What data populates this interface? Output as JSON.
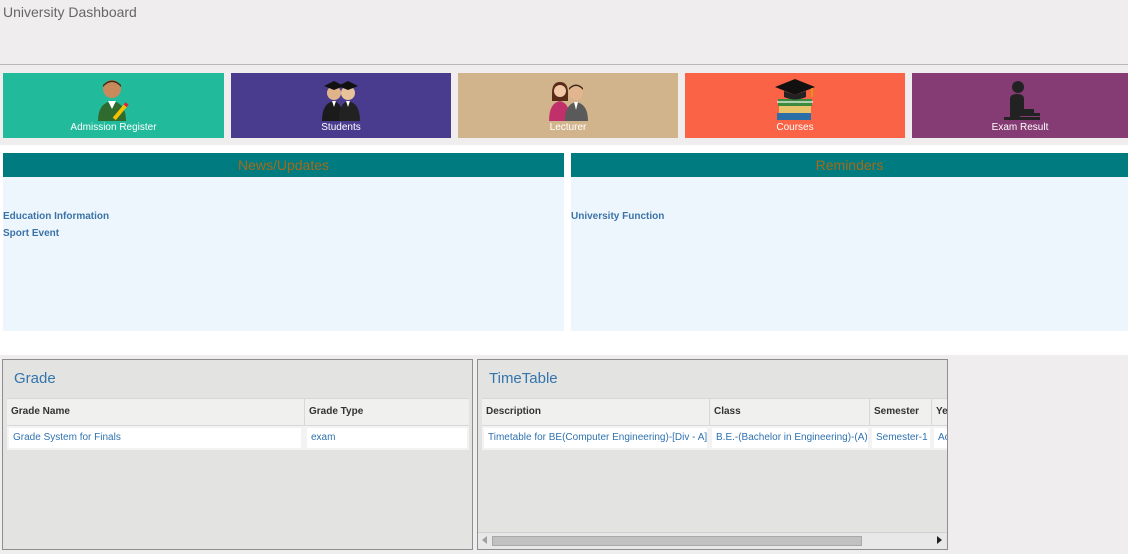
{
  "header": {
    "title": "University Dashboard"
  },
  "tiles": [
    {
      "label": "Admission Register",
      "color": "#21ba9b",
      "icon": "admission-register-icon"
    },
    {
      "label": "Students",
      "color": "#493c8e",
      "icon": "graduates-icon"
    },
    {
      "label": "Lecturer",
      "color": "#d2b48c",
      "icon": "lecturer-icon"
    },
    {
      "label": "Courses",
      "color": "#fb6346",
      "icon": "books-graduation-cap-icon"
    },
    {
      "label": "Exam Result",
      "color": "#853b73",
      "icon": "student-writing-icon"
    }
  ],
  "panels": {
    "news": {
      "title": "News/Updates",
      "items": [
        "Education Information",
        "Sport Event"
      ]
    },
    "reminders": {
      "title": "Reminders",
      "items": [
        "University Function"
      ]
    }
  },
  "grade": {
    "title": "Grade",
    "columns": [
      "Grade Name",
      "Grade Type"
    ],
    "rows": [
      [
        "Grade System for Finals",
        "exam"
      ]
    ]
  },
  "timetable": {
    "title": "TimeTable",
    "columns": [
      "Description",
      "Class",
      "Semester",
      "Ye"
    ],
    "rows": [
      [
        "Timetable for BE(Computer Engineering)-[Div - A]",
        "B.E.-(Bachelor in Engineering)-(A)",
        "Semester-1",
        "Ac"
      ]
    ]
  },
  "colors": {
    "panel_header": "#007b80",
    "panel_header_text": "#a36a1c",
    "panel_body": "#eef6fd",
    "link": "#3b73a8"
  }
}
